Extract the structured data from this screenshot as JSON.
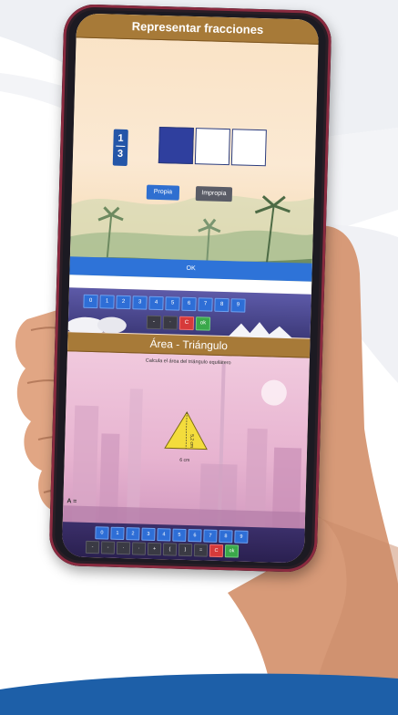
{
  "screen1": {
    "title": "Representar fracciones",
    "fraction": {
      "numerator": "1",
      "denominator": "3"
    },
    "cells": [
      true,
      false,
      false
    ],
    "buttons": {
      "propia": "Propia",
      "impropia": "Impropia"
    },
    "ok_label": "OK",
    "keypad_digits": [
      "0",
      "1",
      "2",
      "3",
      "4",
      "5",
      "6",
      "7",
      "8",
      "9"
    ],
    "keypad_actions": [
      "-",
      "·",
      "C",
      "ok"
    ]
  },
  "screen2": {
    "title": "Área - Triángulo",
    "instruction": "Calcula el área del triángulo equilátero",
    "height_label": "5,2 cm",
    "side_label": "6 cm",
    "answer_label": "A =",
    "keypad_digits": [
      "0",
      "1",
      "2",
      "3",
      "4",
      "5",
      "6",
      "7",
      "8",
      "9"
    ],
    "keypad_actions": [
      "-",
      "-",
      "·",
      "·",
      "+",
      "(",
      ")",
      "=",
      "C",
      "ok"
    ]
  },
  "colors": {
    "title_bar": "#a77a38",
    "accent_blue": "#2e73d8",
    "filled_cell": "#2f3f9e",
    "bottom_band": "#1d5fa8"
  }
}
